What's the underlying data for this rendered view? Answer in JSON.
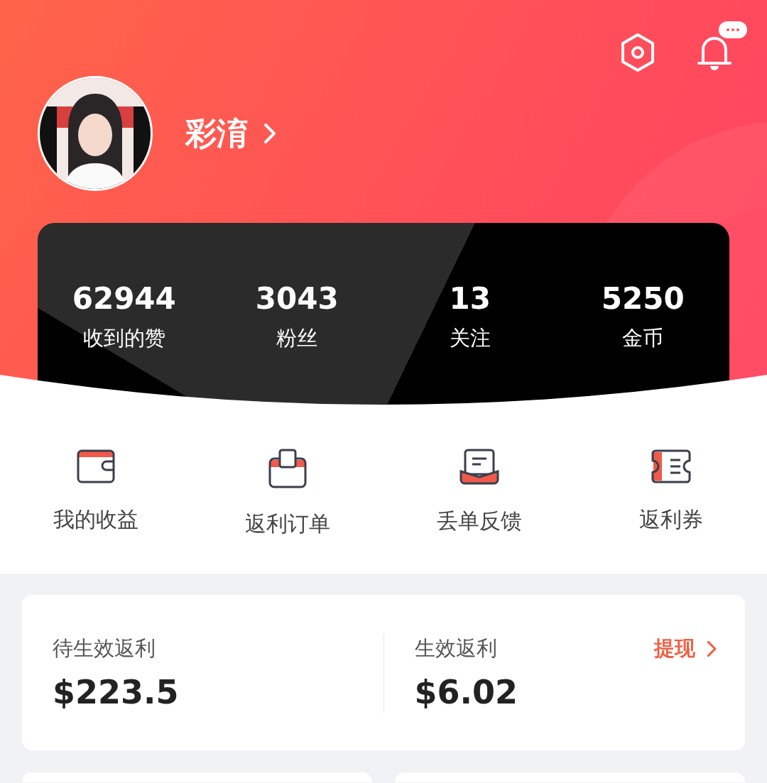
{
  "profile": {
    "username": "彩淯"
  },
  "stats": [
    {
      "value": "62944",
      "label": "收到的赞"
    },
    {
      "value": "3043",
      "label": "粉丝"
    },
    {
      "value": "13",
      "label": "关注"
    },
    {
      "value": "5250",
      "label": "金币"
    }
  ],
  "shortcuts": [
    {
      "kind": "wallet",
      "label": "我的收益"
    },
    {
      "kind": "order",
      "label": "返利订单"
    },
    {
      "kind": "feedback",
      "label": "丢单反馈"
    },
    {
      "kind": "coupon",
      "label": "返利券"
    }
  ],
  "rebates": {
    "pending": {
      "label": "待生效返利",
      "amount": "$223.5"
    },
    "effective": {
      "label": "生效返利",
      "amount": "$6.02"
    },
    "withdraw": "提现"
  }
}
